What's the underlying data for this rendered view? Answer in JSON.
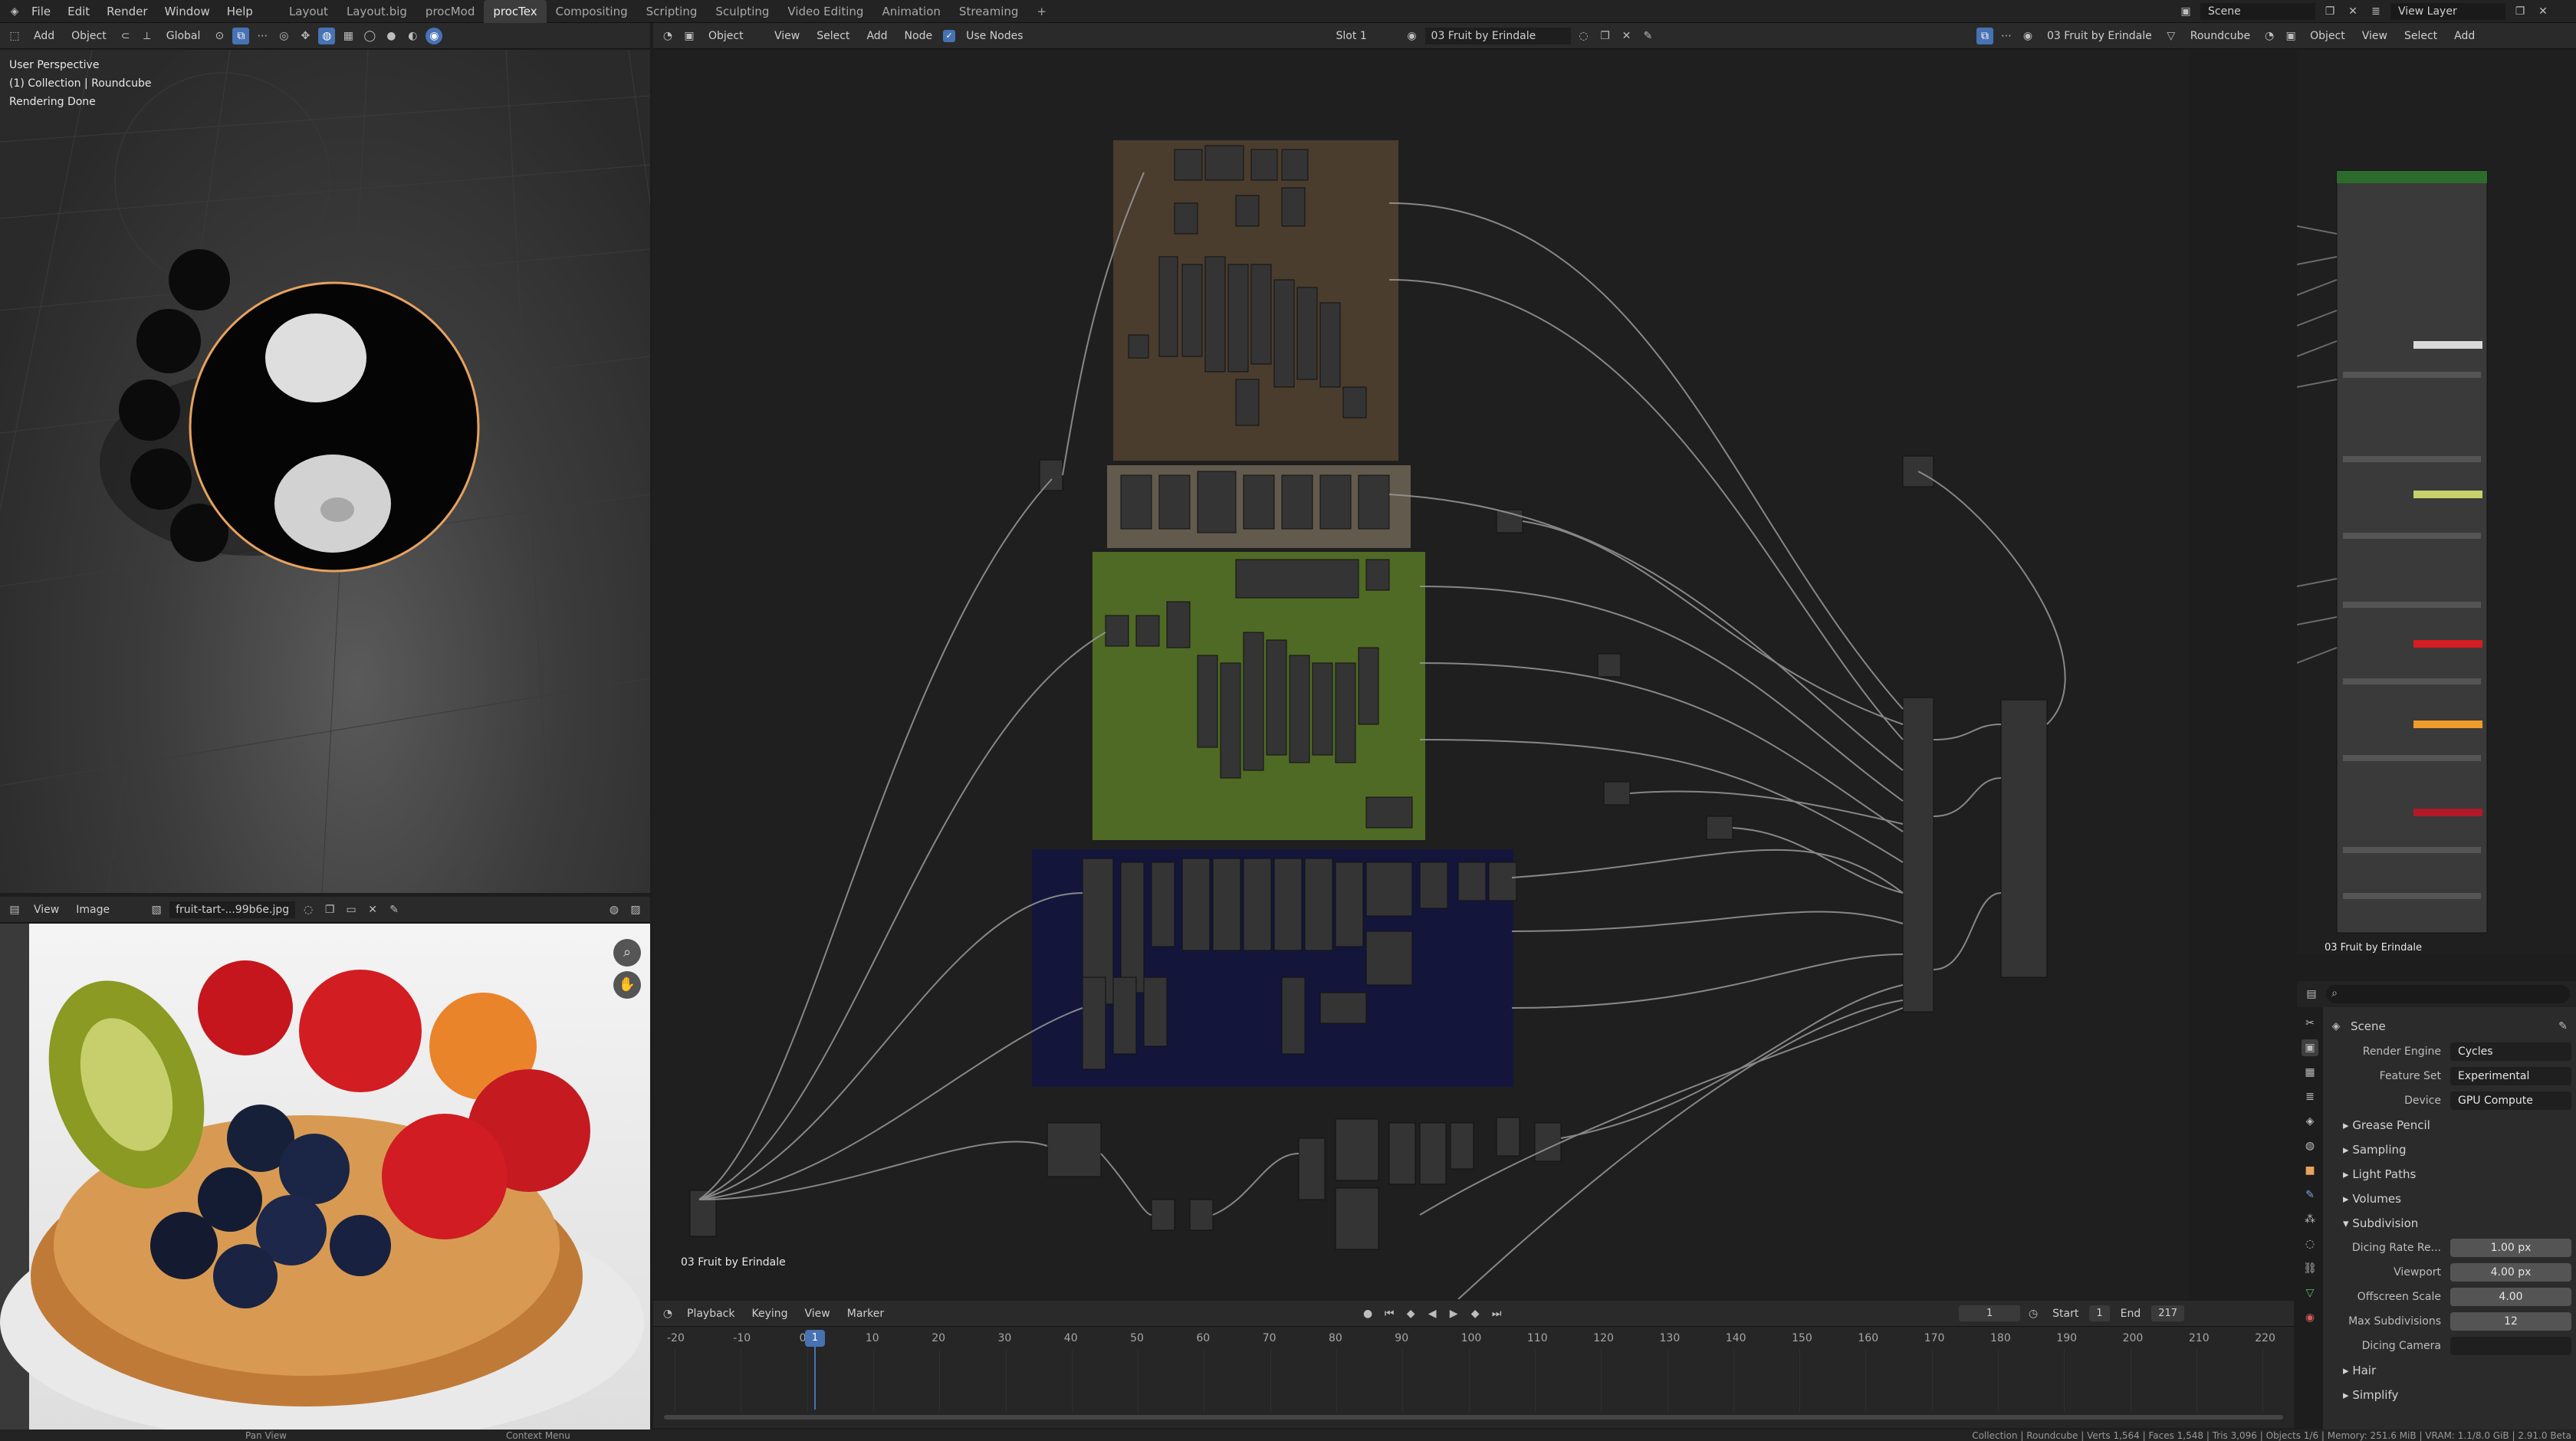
{
  "topbar": {
    "menus": [
      "File",
      "Edit",
      "Render",
      "Window",
      "Help"
    ],
    "workspaces": [
      "Layout",
      "Layout.big",
      "procMod",
      "procTex",
      "Compositing",
      "Scripting",
      "Sculpting",
      "Video Editing",
      "Animation",
      "Streaming"
    ],
    "active_workspace": "procTex",
    "add_tab": "+",
    "scene_label": "Scene",
    "view_layer_label": "View Layer"
  },
  "viewport": {
    "header_items": [
      "Add",
      "Object",
      "Global"
    ],
    "overlay_lines": [
      "User Perspective",
      "(1) Collection | Roundcube",
      "Rendering Done"
    ]
  },
  "node_editor": {
    "header": {
      "mode": "Object",
      "menus": [
        "View",
        "Select",
        "Add",
        "Node"
      ],
      "use_nodes": "Use Nodes",
      "slot": "Slot 1",
      "material": "03 Fruit by Erindale"
    },
    "frame_label": "03 Fruit by Erindale"
  },
  "right_editor": {
    "header": {
      "material": "03 Fruit by Erindale",
      "object": "Roundcube",
      "mode": "Object",
      "menus": [
        "View",
        "Select",
        "Add"
      ]
    },
    "node_label": "03 Fruit by Erindale"
  },
  "image_editor": {
    "menus": [
      "View",
      "Image"
    ],
    "filename": "fruit-tart-...99b6e.jpg"
  },
  "timeline": {
    "menus": [
      "Playback",
      "Keying",
      "View",
      "Marker"
    ],
    "current_frame": "1",
    "start_label": "Start",
    "start": "1",
    "end_label": "End",
    "end": "217",
    "ticks": [
      "-20",
      "-10",
      "0",
      "10",
      "20",
      "30",
      "40",
      "50",
      "60",
      "70",
      "80",
      "90",
      "100",
      "110",
      "120",
      "130",
      "140",
      "150",
      "160",
      "170",
      "180",
      "190",
      "200",
      "210",
      "220"
    ],
    "playhead_frame": "1"
  },
  "properties": {
    "scene": "Scene",
    "rows": [
      {
        "label": "Render Engine",
        "value": "Cycles"
      },
      {
        "label": "Feature Set",
        "value": "Experimental"
      },
      {
        "label": "Device",
        "value": "GPU Compute"
      }
    ],
    "sections": [
      "Grease Pencil",
      "Sampling",
      "Light Paths",
      "Volumes",
      "Subdivision"
    ],
    "subdivision": [
      {
        "label": "Dicing Rate Re...",
        "value": "1.00 px"
      },
      {
        "label": "Viewport",
        "value": "4.00 px"
      },
      {
        "label": "Offscreen Scale",
        "value": "4.00"
      },
      {
        "label": "Max Subdivisions",
        "value": "12"
      },
      {
        "label": "Dicing Camera",
        "value": ""
      }
    ],
    "more_sections": [
      "Hair",
      "Simplify"
    ]
  },
  "statusbar": {
    "pan": "Pan View",
    "context": "Context Menu",
    "stats": "Collection | Roundcube | Verts 1,564 | Faces 1,548 | Tris 3,096 | Objects 1/6 | Memory: 251.6 MiB | VRAM: 1.1/8.0 GiB | 2.91.0 Beta"
  },
  "colors": {
    "accent": "#4772b3",
    "frame_brown": "#4a3d2e",
    "frame_tan": "#625a4d",
    "frame_green": "#4f6a24",
    "frame_navy": "#13163a",
    "selection_orange": "#e8a25d"
  }
}
